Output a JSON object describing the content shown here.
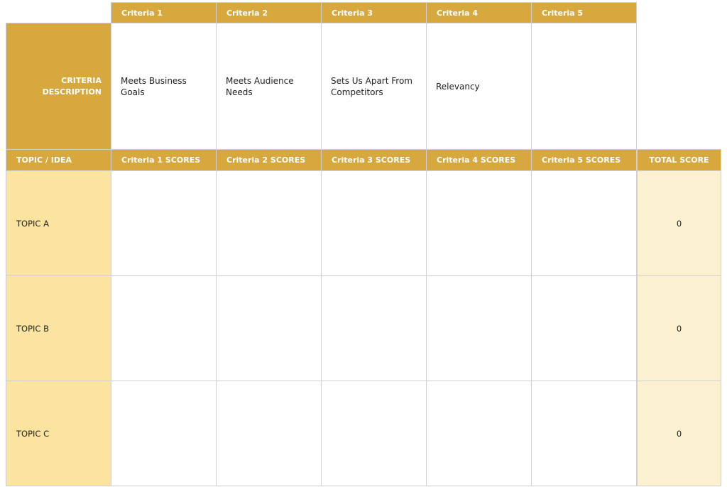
{
  "criteria_headers": [
    "Criteria 1",
    "Criteria 2",
    "Criteria 3",
    "Criteria 4",
    "Criteria 5"
  ],
  "criteria_description_label": "CRITERIA DESCRIPTION",
  "criteria_descriptions": [
    "Meets Business Goals",
    "Meets Audience Needs",
    "Sets Us Apart From Competitors",
    "Relevancy",
    ""
  ],
  "score_headers": {
    "topic_label": "TOPIC / IDEA",
    "criteria_scores": [
      "Criteria 1 SCORES",
      "Criteria 2 SCORES",
      "Criteria 3 SCORES",
      "Criteria 4 SCORES",
      "Criteria 5 SCORES"
    ],
    "total_label": "TOTAL SCORE"
  },
  "topics": [
    {
      "name": "TOPIC A",
      "scores": [
        "",
        "",
        "",
        "",
        ""
      ],
      "total": "0"
    },
    {
      "name": "TOPIC B",
      "scores": [
        "",
        "",
        "",
        "",
        ""
      ],
      "total": "0"
    },
    {
      "name": "TOPIC C",
      "scores": [
        "",
        "",
        "",
        "",
        ""
      ],
      "total": "0"
    }
  ],
  "colors": {
    "header_gold": "#d6a83e",
    "topic_fill": "#fae49f",
    "total_fill": "#fbf0cf",
    "grid": "#d0d0d0"
  }
}
